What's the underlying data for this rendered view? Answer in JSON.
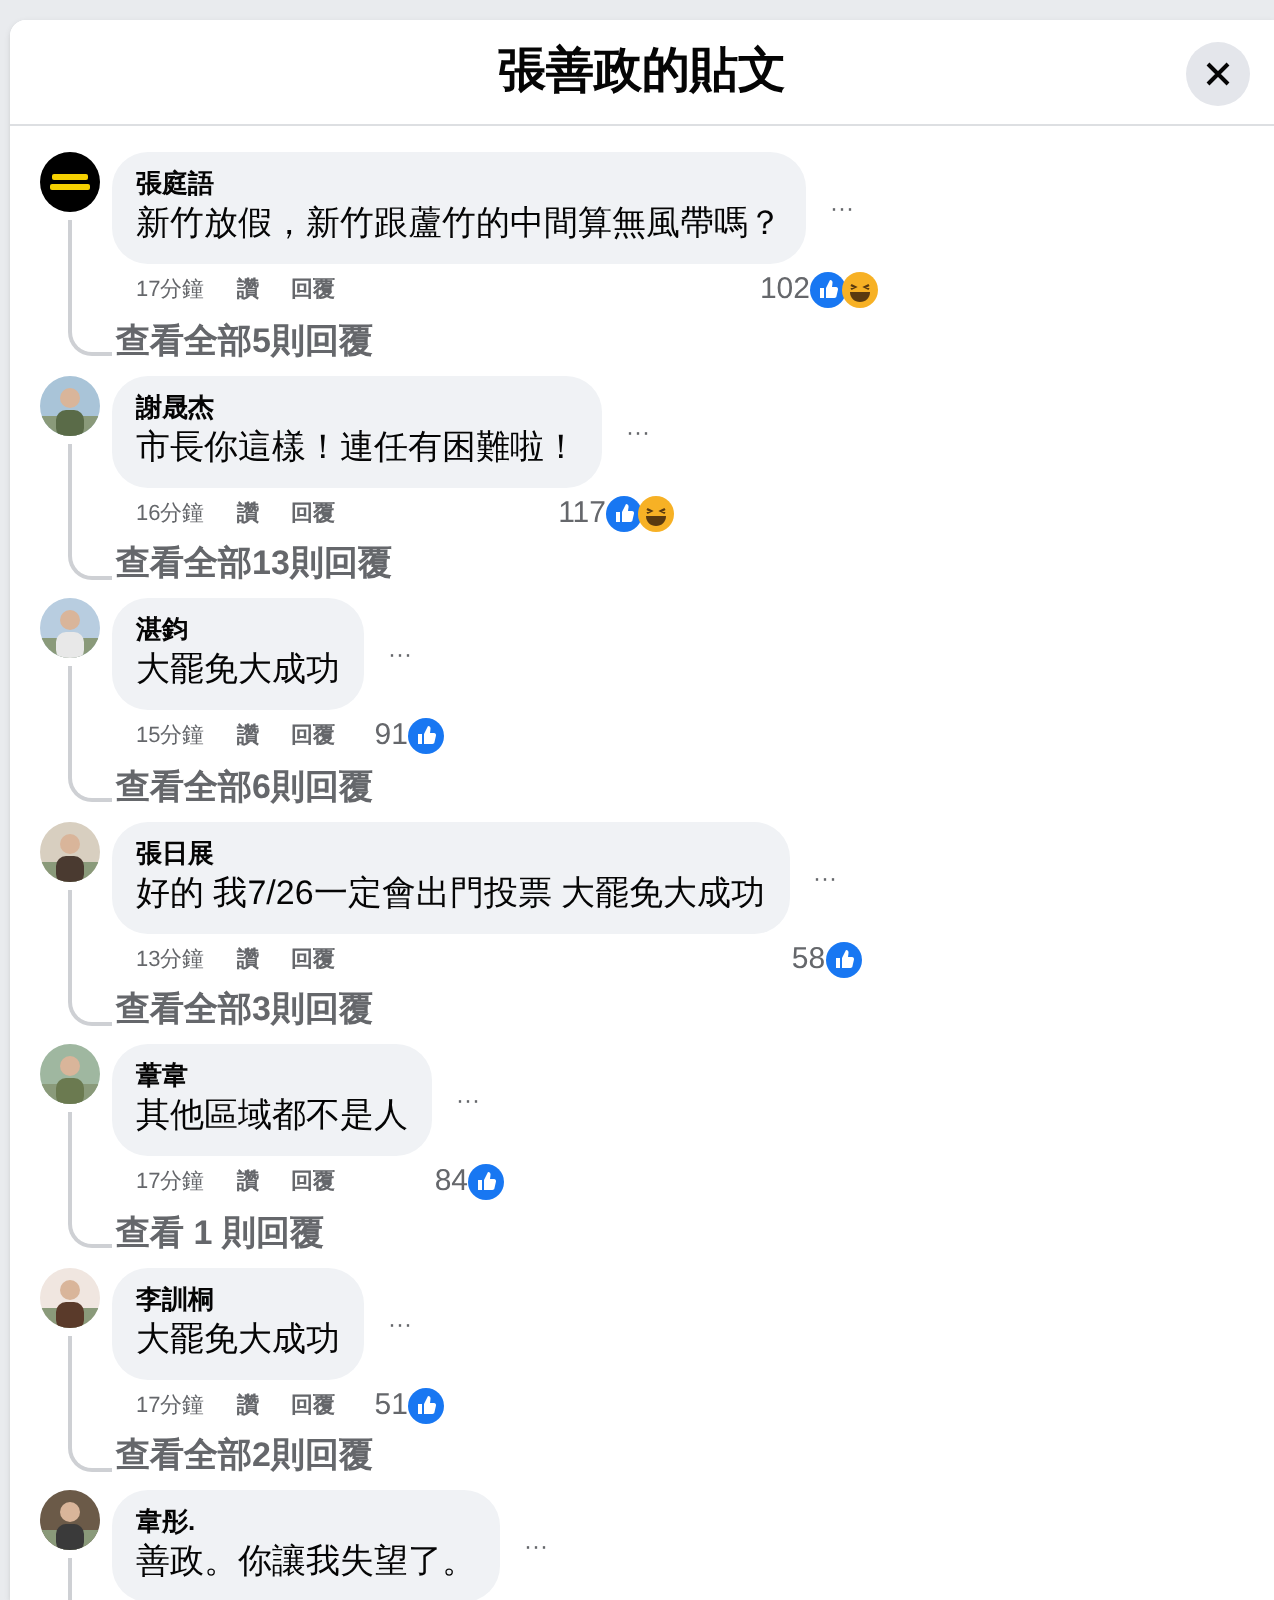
{
  "dialog": {
    "title": "張善政的貼文"
  },
  "comments": [
    {
      "name": "張庭語",
      "text": "新竹放假，新竹跟蘆竹的中間算無風帶嗎？",
      "menu": "···",
      "time": "17分鐘",
      "like": "讚",
      "reply": "回覆",
      "count": "102",
      "reactions": [
        {
          "kind": "like"
        },
        {
          "kind": "haha"
        }
      ],
      "replies_link": "查看全部5則回覆",
      "avatar": {
        "kind": "logo"
      }
    },
    {
      "name": "謝晟杰",
      "text": "市長你這樣！連任有困難啦！",
      "menu": "···",
      "time": "16分鐘",
      "like": "讚",
      "reply": "回覆",
      "count": "117",
      "reactions": [
        {
          "kind": "like"
        },
        {
          "kind": "haha"
        }
      ],
      "replies_link": "查看全部13則回覆",
      "avatar": {
        "kind": "picture"
      }
    },
    {
      "name": "湛鈞",
      "text": "大罷免大成功",
      "menu": "···",
      "time": "15分鐘",
      "like": "讚",
      "reply": "回覆",
      "count": "91",
      "reactions": [
        {
          "kind": "like"
        }
      ],
      "replies_link": "查看全部6則回覆",
      "avatar": {
        "kind": "picture"
      }
    },
    {
      "name": "張日展",
      "text": "好的 我7/26一定會出門投票 大罷免大成功",
      "menu": "···",
      "time": "13分鐘",
      "like": "讚",
      "reply": "回覆",
      "count": "58",
      "reactions": [
        {
          "kind": "like"
        }
      ],
      "replies_link": "查看全部3則回覆",
      "avatar": {
        "kind": "picture"
      }
    },
    {
      "name": "葦韋",
      "text": "其他區域都不是人",
      "menu": "···",
      "time": "17分鐘",
      "like": "讚",
      "reply": "回覆",
      "count": "84",
      "reactions": [
        {
          "kind": "like"
        }
      ],
      "replies_link": "查看 1 則回覆",
      "avatar": {
        "kind": "picture"
      }
    },
    {
      "name": "李訓桐",
      "text": "大罷免大成功",
      "menu": "···",
      "time": "17分鐘",
      "like": "讚",
      "reply": "回覆",
      "count": "51",
      "reactions": [
        {
          "kind": "like"
        }
      ],
      "replies_link": "查看全部2則回覆",
      "avatar": {
        "kind": "picture"
      }
    },
    {
      "name": "韋彤.",
      "text": "善政。你讓我失望了。",
      "menu": "···",
      "avatar": {
        "kind": "picture"
      }
    }
  ]
}
